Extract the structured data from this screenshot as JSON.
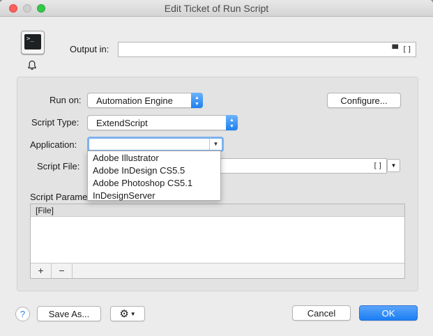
{
  "window": {
    "title": "Edit Ticket of Run Script"
  },
  "header": {
    "output_label": "Output in:",
    "output_value": "",
    "output_end_icons": "▀ []",
    "script_icon_text": ">_"
  },
  "form": {
    "run_on_label": "Run on:",
    "run_on_value": "Automation Engine",
    "configure_label": "Configure...",
    "script_type_label": "Script Type:",
    "script_type_value": "ExtendScript",
    "application_label": "Application:",
    "application_value": "",
    "application_options": [
      "Adobe Illustrator",
      "Adobe InDesign CS5.5",
      "Adobe Photoshop CS5.1",
      "InDesignServer"
    ],
    "script_file_label": "Script File:",
    "script_file_value": "",
    "script_file_icon": "[]",
    "script_params_label": "Script Parame",
    "params_header": "[File]",
    "add_label": "+",
    "remove_label": "−"
  },
  "footer": {
    "help_label": "?",
    "save_as_label": "Save As...",
    "cancel_label": "Cancel",
    "ok_label": "OK"
  },
  "colors": {
    "accent": "#1a7ef4",
    "focus_ring": "#7db2ef",
    "close": "#fc605c",
    "maximize": "#34c84a"
  }
}
